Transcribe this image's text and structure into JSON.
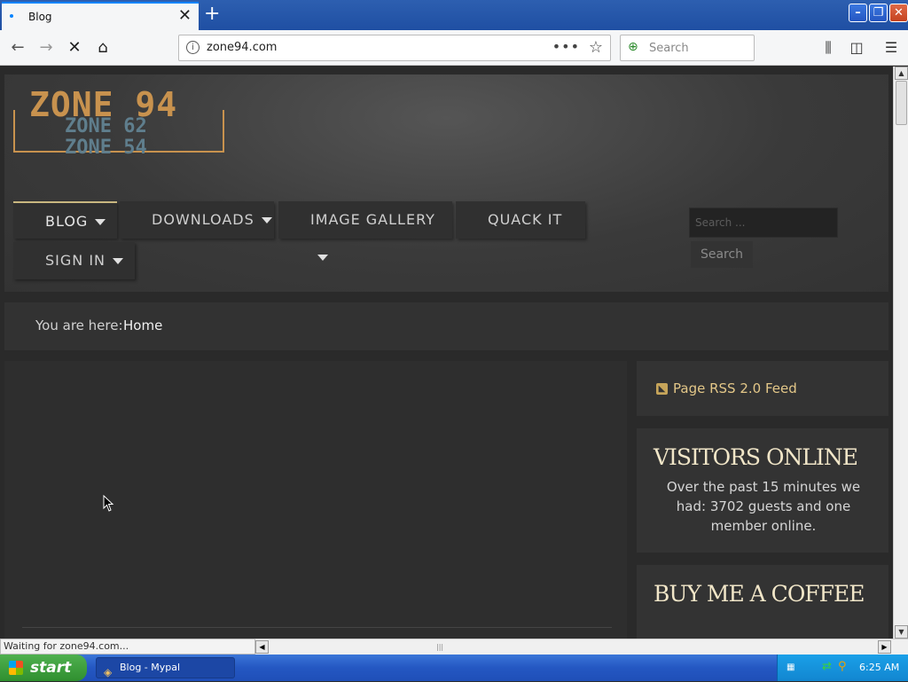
{
  "browser": {
    "tab_title": "Blog",
    "url": "zone94.com",
    "search_placeholder": "Search",
    "status_text": "Waiting for zone94.com..."
  },
  "site": {
    "logo_line1": "ZONE 94",
    "logo_line2": "ZONE 62",
    "logo_line3": "ZONE 54",
    "menu": [
      {
        "label": "BLOG",
        "has_dropdown": true,
        "active": true
      },
      {
        "label": "DOWNLOADS",
        "has_dropdown": true
      },
      {
        "label": "IMAGE GALLERY",
        "has_dropdown": true
      },
      {
        "label": "QUACK IT",
        "has_dropdown": false
      },
      {
        "label": "SIGN IN",
        "has_dropdown": true
      }
    ],
    "search_placeholder": "Search ...",
    "search_button": "Search",
    "breadcrumb_label": "You are here:",
    "breadcrumb_current": "Home",
    "rss_label": "Page RSS 2.0 Feed",
    "visitors_title": "VISITORS ONLINE",
    "visitors_text": "Over the past 15 minutes we had: 3702 guests and one member online.",
    "coffee_title": "BUY ME A COFFEE"
  },
  "taskbar": {
    "start_label": "start",
    "task_label": "Blog - Mypal",
    "clock": "6:25 AM"
  },
  "colors": {
    "accent_gold": "#c8924e",
    "widget_title": "#f1e6c8",
    "rss_link": "#e3c788"
  }
}
